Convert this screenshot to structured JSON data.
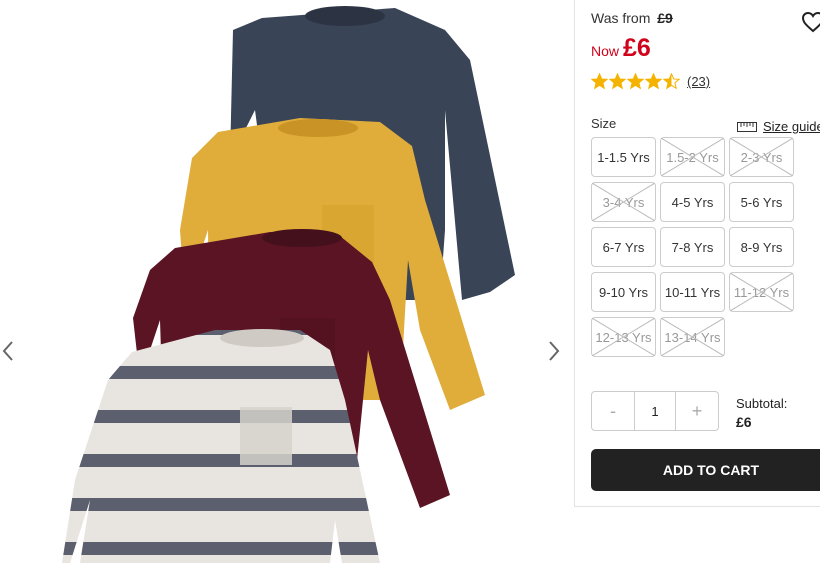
{
  "product": {
    "was_label": "Was from",
    "was_price": "£9",
    "now_label": "Now",
    "now_price": "£6",
    "rating": 4.5,
    "review_count": "(23)"
  },
  "size": {
    "label": "Size",
    "guide_label": "Size guide",
    "options": [
      {
        "label": "1-1.5 Yrs",
        "available": true
      },
      {
        "label": "1.5-2 Yrs",
        "available": false
      },
      {
        "label": "2-3 Yrs",
        "available": false
      },
      {
        "label": "3-4 Yrs",
        "available": false
      },
      {
        "label": "4-5 Yrs",
        "available": true
      },
      {
        "label": "5-6 Yrs",
        "available": true
      },
      {
        "label": "6-7 Yrs",
        "available": true
      },
      {
        "label": "7-8 Yrs",
        "available": true
      },
      {
        "label": "8-9 Yrs",
        "available": true
      },
      {
        "label": "9-10 Yrs",
        "available": true
      },
      {
        "label": "10-11 Yrs",
        "available": true
      },
      {
        "label": "11-12 Yrs",
        "available": false
      },
      {
        "label": "12-13 Yrs",
        "available": false
      },
      {
        "label": "13-14 Yrs",
        "available": false
      }
    ]
  },
  "quantity": {
    "minus": "-",
    "value": "1",
    "plus": "+"
  },
  "subtotal": {
    "label": "Subtotal:",
    "value": "£6"
  },
  "cart": {
    "add_label": "ADD TO CART"
  },
  "colors": {
    "sale_red": "#d0021b",
    "star_gold": "#f5b301",
    "button_dark": "#222222"
  },
  "icons": {
    "prev": "chevron-left-icon",
    "next": "chevron-right-icon",
    "wishlist": "heart-icon",
    "size_guide": "ruler-icon"
  }
}
